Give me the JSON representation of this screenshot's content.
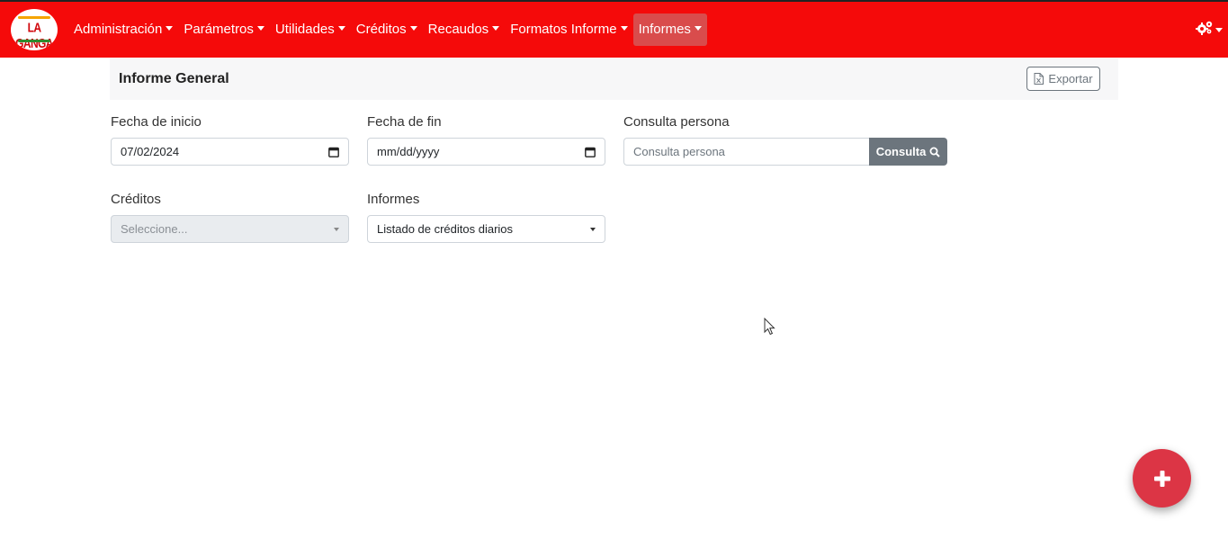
{
  "app": {
    "logo_text": "LA GANGA"
  },
  "nav": {
    "items": [
      {
        "label": "Administración",
        "icon": "chevron-down-icon"
      },
      {
        "label": "Parámetros",
        "icon": "chevron-down-icon"
      },
      {
        "label": "Utilidades",
        "icon": "chevron-down-icon"
      },
      {
        "label": "Créditos",
        "icon": "chevron-down-icon"
      },
      {
        "label": "Recaudos",
        "icon": "chevron-down-icon"
      },
      {
        "label": "Formatos Informe",
        "icon": "chevron-down-icon"
      },
      {
        "label": "Informes",
        "icon": "chevron-down-icon",
        "active": true
      }
    ],
    "settings_icon": "gears-icon",
    "colors": {
      "bar": "#f50a0a",
      "active": "#d94c4c"
    }
  },
  "panel": {
    "title": "Informe General",
    "export_label": "Exportar",
    "export_icon": "file-excel-icon"
  },
  "form": {
    "fecha_inicio": {
      "label": "Fecha de inicio",
      "value": "07/02/2024",
      "icon": "calendar-icon"
    },
    "fecha_fin": {
      "label": "Fecha de fin",
      "placeholder": "mm/dd/yyyy",
      "icon": "calendar-icon"
    },
    "consulta": {
      "label": "Consulta persona",
      "placeholder": "Consulta persona",
      "button_label": "Consulta",
      "button_icon": "search-icon"
    },
    "creditos": {
      "label": "Créditos",
      "placeholder": "Seleccione...",
      "disabled": true
    },
    "informes": {
      "label": "Informes",
      "value": "Listado de créditos diarios"
    }
  },
  "fab": {
    "icon": "plus-icon",
    "color": "#dc3545"
  }
}
